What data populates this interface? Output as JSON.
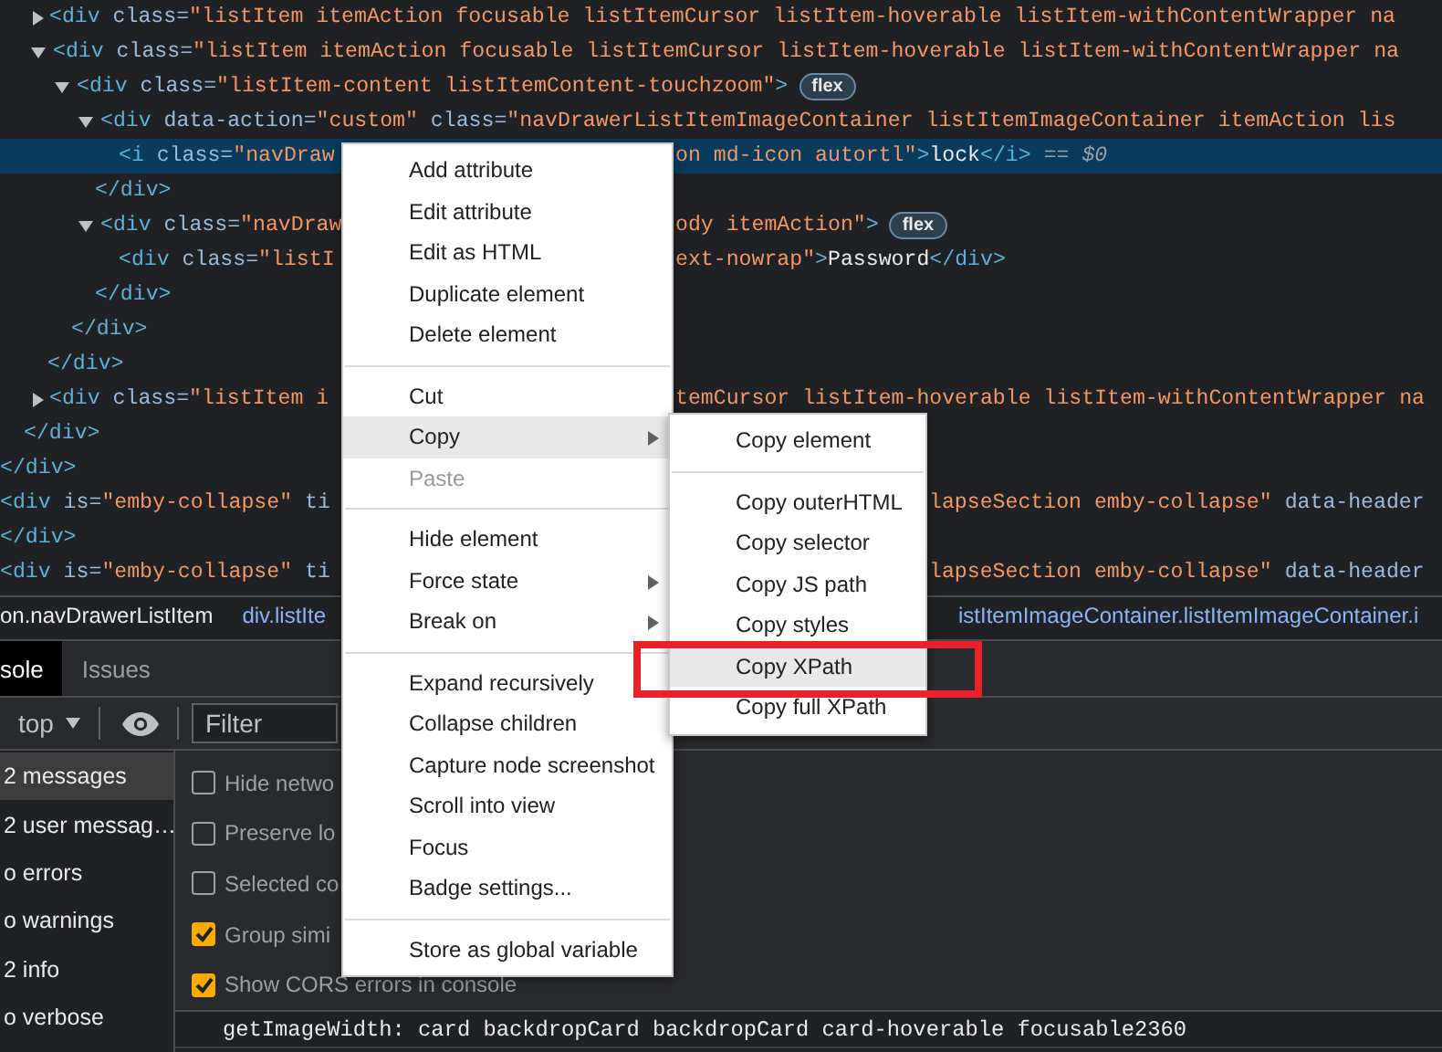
{
  "elements_tree": [
    {
      "children": [
        {
          "children": [
            {
              "open": {
                "left": [
                  {
                    "kind": "tag",
                    "text": "<div"
                  },
                  {
                    "kind": "attr",
                    "text": " class="
                  },
                  {
                    "kind": "value",
                    "text": "\"listItem itemAction focusable listItemCursor listItem-hoverable listItem-withContentWrapper na"
                  }
                ]
              },
              "expanded": false,
              "selected": false
            },
            {
              "open": {
                "left": [
                  {
                    "kind": "tag",
                    "text": "<div"
                  },
                  {
                    "kind": "attr",
                    "text": " class="
                  },
                  {
                    "kind": "value",
                    "text": "\"listItem itemAction focusable listItemCursor listItem-hoverable listItem-withContentWrapper na"
                  }
                ]
              },
              "expanded": true,
              "selected": false,
              "children": [
                {
                  "open": {
                    "left": [
                      {
                        "kind": "tag",
                        "text": "<div"
                      },
                      {
                        "kind": "attr",
                        "text": " class="
                      },
                      {
                        "kind": "value",
                        "text": "\"listItem-content listItemContent-touchzoom\""
                      },
                      {
                        "kind": "tag",
                        "text": ">"
                      }
                    ],
                    "badge": "flex"
                  },
                  "expanded": true,
                  "selected": false,
                  "children": [
                    {
                      "open": {
                        "left": [
                          {
                            "kind": "tag",
                            "text": "<div"
                          },
                          {
                            "kind": "attr",
                            "text": " data-action="
                          },
                          {
                            "kind": "value",
                            "text": "\"custom\""
                          },
                          {
                            "kind": "attr",
                            "text": " class="
                          },
                          {
                            "kind": "value",
                            "text": "\"navDrawerListItemImageContainer listItemImageContainer itemAction lis"
                          }
                        ]
                      },
                      "expanded": true,
                      "selected": false,
                      "children": [
                        {
                          "open": {
                            "left": [
                              {
                                "kind": "tag",
                                "text": "<i"
                              },
                              {
                                "kind": "attr",
                                "text": " class="
                              },
                              {
                                "kind": "value",
                                "text": "\"navDraw"
                              }
                            ],
                            "right": [
                              {
                                "kind": "value",
                                "text": "on md-icon autortl\""
                              },
                              {
                                "kind": "tag",
                                "text": ">"
                              },
                              {
                                "kind": "text",
                                "text": "lock"
                              },
                              {
                                "kind": "tag",
                                "text": "</i>"
                              },
                              {
                                "kind": "meta",
                                "text": " == $0"
                              }
                            ]
                          },
                          "selected": true
                        }
                      ],
                      "close": {
                        "left": [
                          {
                            "kind": "tag",
                            "text": "</div>"
                          }
                        ]
                      }
                    },
                    {
                      "open": {
                        "left": [
                          {
                            "kind": "tag",
                            "text": "<div"
                          },
                          {
                            "kind": "attr",
                            "text": " class="
                          },
                          {
                            "kind": "value",
                            "text": "\"navDraw"
                          }
                        ],
                        "right": [
                          {
                            "kind": "value",
                            "text": "ody itemAction\""
                          },
                          {
                            "kind": "tag",
                            "text": ">"
                          }
                        ],
                        "badge": "flex"
                      },
                      "expanded": true,
                      "selected": false,
                      "children": [
                        {
                          "open": {
                            "left": [
                              {
                                "kind": "tag",
                                "text": "<div"
                              },
                              {
                                "kind": "attr",
                                "text": " class="
                              },
                              {
                                "kind": "value",
                                "text": "\"listI"
                              }
                            ],
                            "right": [
                              {
                                "kind": "value",
                                "text": "ext-nowrap\""
                              },
                              {
                                "kind": "tag",
                                "text": ">"
                              },
                              {
                                "kind": "text",
                                "text": "Password"
                              },
                              {
                                "kind": "tag",
                                "text": "</div>"
                              }
                            ]
                          },
                          "selected": false
                        }
                      ],
                      "close": {
                        "left": [
                          {
                            "kind": "tag",
                            "text": "</div>"
                          }
                        ]
                      }
                    }
                  ],
                  "close": {
                    "left": [
                      {
                        "kind": "tag",
                        "text": "</div>"
                      }
                    ]
                  }
                }
              ],
              "close": {
                "left": [
                  {
                    "kind": "tag",
                    "text": "</div>"
                  }
                ]
              }
            },
            {
              "open": {
                "left": [
                  {
                    "kind": "tag",
                    "text": "<div"
                  },
                  {
                    "kind": "attr",
                    "text": " class="
                  },
                  {
                    "kind": "value",
                    "text": "\"listItem i"
                  }
                ],
                "right": [
                  {
                    "kind": "value",
                    "text": "temCursor listItem-hoverable listItem-withContentWrapper na"
                  }
                ]
              },
              "expanded": false,
              "selected": false
            }
          ],
          "close": {
            "left": [
              {
                "kind": "tag",
                "text": "</div>"
              }
            ]
          }
        }
      ],
      "close": {
        "left": [
          {
            "kind": "tag",
            "text": "</div>"
          }
        ]
      }
    },
    {
      "open": {
        "left": [
          {
            "kind": "tag",
            "text": "<div"
          },
          {
            "kind": "attr",
            "text": " is="
          },
          {
            "kind": "value",
            "text": "\"emby-collapse\""
          },
          {
            "kind": "attr",
            "text": " ti"
          }
        ],
        "right": [
          {
            "kind": "value",
            "text": "lapseSection emby-collapse\""
          },
          {
            "kind": "attr",
            "text": " data-header"
          }
        ]
      },
      "selected": false,
      "close": {
        "left": [
          {
            "kind": "tag",
            "text": "</div>"
          }
        ]
      }
    },
    {
      "open": {
        "left": [
          {
            "kind": "tag",
            "text": "<div"
          },
          {
            "kind": "attr",
            "text": " is="
          },
          {
            "kind": "value",
            "text": "\"emby-collapse\""
          },
          {
            "kind": "attr",
            "text": " ti"
          }
        ],
        "right": [
          {
            "kind": "value",
            "text": "lapseSection emby-collapse\""
          },
          {
            "kind": "attr",
            "text": " data-header"
          }
        ]
      },
      "selected": false
    }
  ],
  "breadcrumbs": {
    "items": [
      {
        "text": "on.navDrawerListItem",
        "kind": "plain"
      },
      {
        "text": "div.listIte",
        "kind": "link"
      }
    ],
    "tail": "istItemImageContainer.listItemImageContainer.i"
  },
  "console": {
    "tabs": [
      {
        "label": "sole",
        "selected": true
      },
      {
        "label": "Issues",
        "selected": false
      }
    ],
    "toolbar": {
      "context": "top",
      "filter": {
        "placeholder": "Filter"
      }
    },
    "sidebar": [
      {
        "label": "2 messages",
        "selected": true
      },
      {
        "label": "2 user messag…",
        "selected": false
      },
      {
        "label": "o errors",
        "selected": false
      },
      {
        "label": "o warnings",
        "selected": false
      },
      {
        "label": "2 info",
        "selected": false
      },
      {
        "label": "o verbose",
        "selected": false
      }
    ],
    "settings": [
      {
        "label": "Hide netwo",
        "checked": false
      },
      {
        "label": "Preserve lo",
        "checked": false
      },
      {
        "label": "Selected co",
        "checked": false
      },
      {
        "label": "Group simi",
        "checked": true
      },
      {
        "label": "Show CORS errors in console",
        "checked": true
      }
    ],
    "output": [
      "getImageWidth: card backdropCard backdropCard card-hoverable focusable2360"
    ]
  },
  "context_menu": {
    "items": [
      {
        "kind": "item",
        "label": "Add attribute",
        "selected": false,
        "disabled": false
      },
      {
        "kind": "item",
        "label": "Edit attribute",
        "selected": false,
        "disabled": false
      },
      {
        "kind": "item",
        "label": "Edit as HTML",
        "selected": false,
        "disabled": false
      },
      {
        "kind": "item",
        "label": "Duplicate element",
        "selected": false,
        "disabled": false
      },
      {
        "kind": "item",
        "label": "Delete element",
        "selected": false,
        "disabled": false
      },
      {
        "kind": "separator"
      },
      {
        "kind": "item",
        "label": "Cut",
        "selected": false,
        "disabled": false
      },
      {
        "kind": "item",
        "label": "Copy",
        "selected": true,
        "disabled": false,
        "has_submenu": true,
        "submenu": [
          {
            "kind": "item",
            "label": "Copy element",
            "selected": false,
            "disabled": false
          },
          {
            "kind": "separator"
          },
          {
            "kind": "item",
            "label": "Copy outerHTML",
            "selected": false,
            "disabled": false
          },
          {
            "kind": "item",
            "label": "Copy selector",
            "selected": false,
            "disabled": false
          },
          {
            "kind": "item",
            "label": "Copy JS path",
            "selected": false,
            "disabled": false
          },
          {
            "kind": "item",
            "label": "Copy styles",
            "selected": false,
            "disabled": false
          },
          {
            "kind": "item",
            "label": "Copy XPath",
            "selected": true,
            "disabled": false
          },
          {
            "kind": "item",
            "label": "Copy full XPath",
            "selected": false,
            "disabled": false
          }
        ]
      },
      {
        "kind": "item",
        "label": "Paste",
        "selected": false,
        "disabled": true
      },
      {
        "kind": "separator"
      },
      {
        "kind": "item",
        "label": "Hide element",
        "selected": false,
        "disabled": false
      },
      {
        "kind": "item",
        "label": "Force state",
        "selected": false,
        "disabled": false,
        "has_submenu": true
      },
      {
        "kind": "item",
        "label": "Break on",
        "selected": false,
        "disabled": false,
        "has_submenu": true
      },
      {
        "kind": "separator"
      },
      {
        "kind": "item",
        "label": "Expand recursively",
        "selected": false,
        "disabled": false
      },
      {
        "kind": "item",
        "label": "Collapse children",
        "selected": false,
        "disabled": false
      },
      {
        "kind": "item",
        "label": "Capture node screenshot",
        "selected": false,
        "disabled": false
      },
      {
        "kind": "item",
        "label": "Scroll into view",
        "selected": false,
        "disabled": false
      },
      {
        "kind": "item",
        "label": "Focus",
        "selected": false,
        "disabled": false
      },
      {
        "kind": "item",
        "label": "Badge settings...",
        "selected": false,
        "disabled": false
      },
      {
        "kind": "separator"
      },
      {
        "kind": "item",
        "label": "Store as global variable",
        "selected": false,
        "disabled": false
      }
    ]
  }
}
